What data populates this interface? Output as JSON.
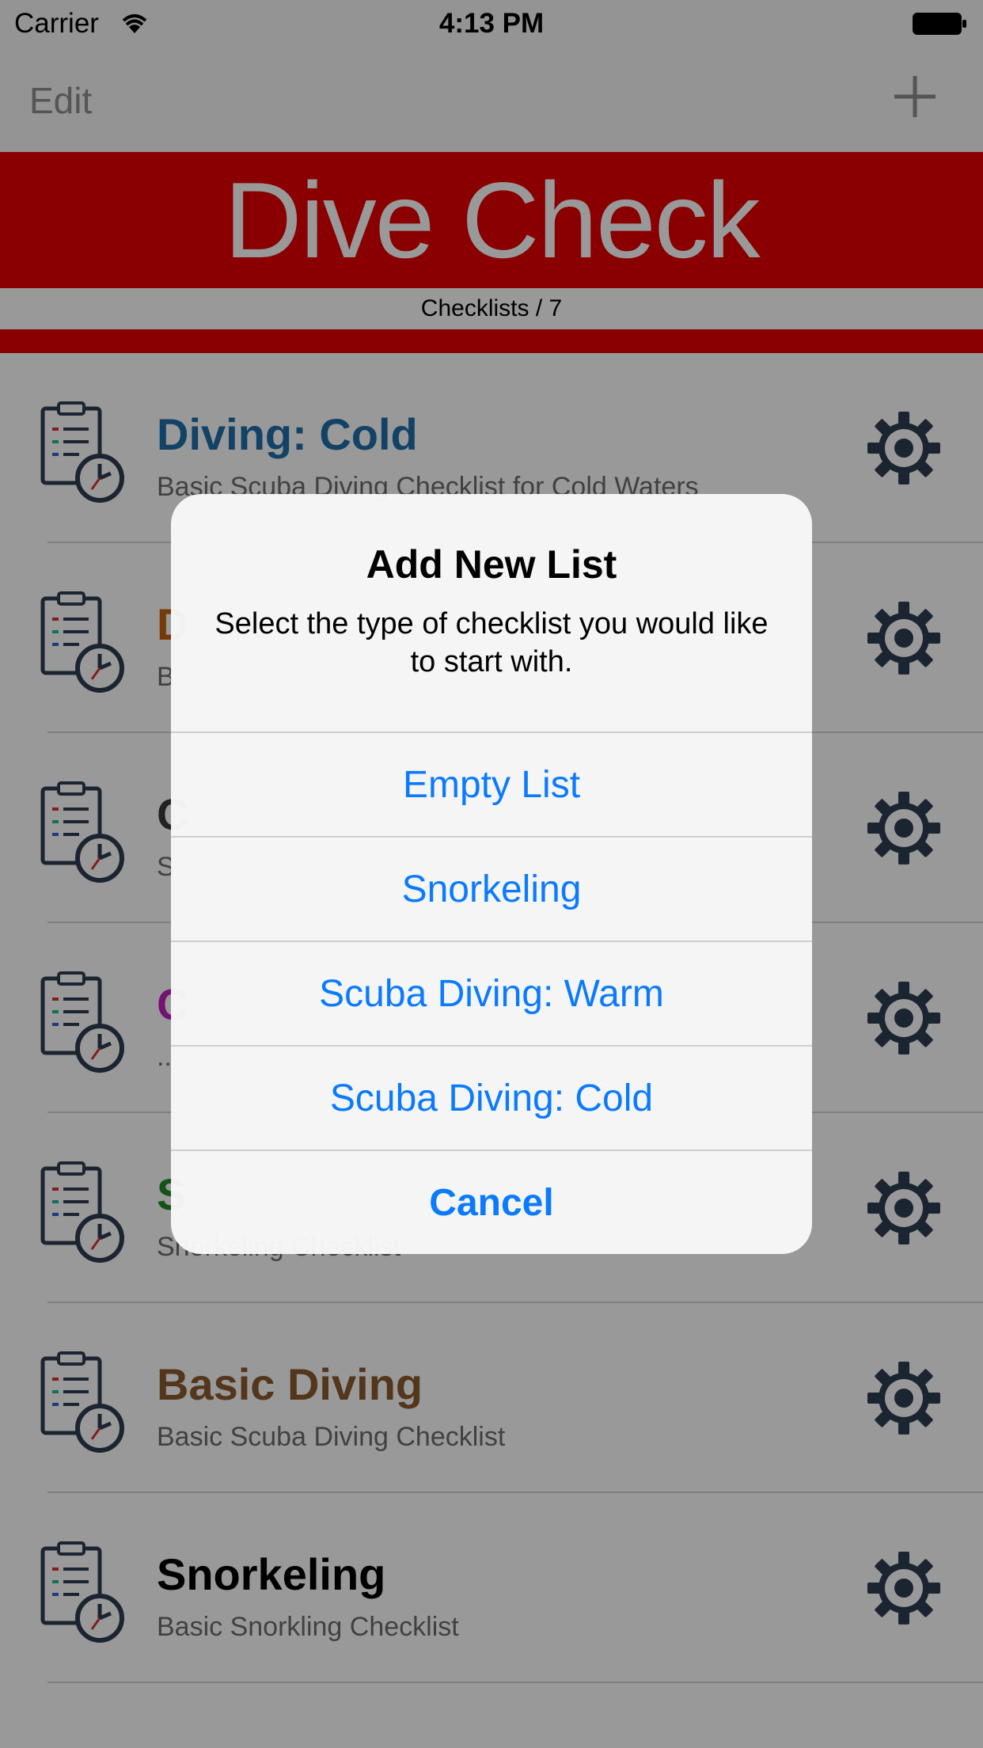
{
  "status_bar": {
    "carrier": "Carrier",
    "time": "4:13 PM"
  },
  "nav": {
    "edit_label": "Edit",
    "add_icon": "plus-icon"
  },
  "header": {
    "title": "Dive Check",
    "subtitle": "Checklists / 7"
  },
  "colors": {
    "brand_red": "#e60000",
    "action_blue": "#0a7aff",
    "gear": "#2e3f52"
  },
  "list": [
    {
      "title": "Diving: Cold",
      "title_visible": "Diving: Cold",
      "subtitle": "Basic Scuba Diving Checklist for Cold Waters",
      "subtitle_visible": "Basic Scuba Diving Checklist for Cold Waters",
      "color": "#1e6fa8"
    },
    {
      "title": "D",
      "title_visible": "D",
      "subtitle": "B",
      "subtitle_visible": "B",
      "color": "#c4610f"
    },
    {
      "title": "C",
      "title_visible": "C",
      "subtitle": "S",
      "subtitle_visible": "S",
      "color": "#3a3a3a"
    },
    {
      "title": "C",
      "title_visible": "C",
      "subtitle": "...",
      "subtitle_visible": "...",
      "color": "#c01fc0"
    },
    {
      "title": "S",
      "title_visible": "S",
      "subtitle": "Snorkeling Checklist",
      "subtitle_visible": "Snorkeling Checklist",
      "color": "#1e8a2a"
    },
    {
      "title": "Basic Diving",
      "title_visible": "Basic Diving",
      "subtitle": "Basic Scuba Diving Checklist",
      "subtitle_visible": "Basic Scuba Diving Checklist",
      "color": "#8a5a2e"
    },
    {
      "title": "Snorkeling",
      "title_visible": "Snorkeling",
      "subtitle": "Basic Snorkling Checklist",
      "subtitle_visible": "Basic Snorkling Checklist",
      "color": "#000000"
    }
  ],
  "alert": {
    "title": "Add New List",
    "message": "Select the type of checklist you would like to start with.",
    "buttons": [
      {
        "label": "Empty List"
      },
      {
        "label": "Snorkeling"
      },
      {
        "label": "Scuba Diving: Warm"
      },
      {
        "label": "Scuba Diving: Cold"
      },
      {
        "label": "Cancel"
      }
    ]
  }
}
